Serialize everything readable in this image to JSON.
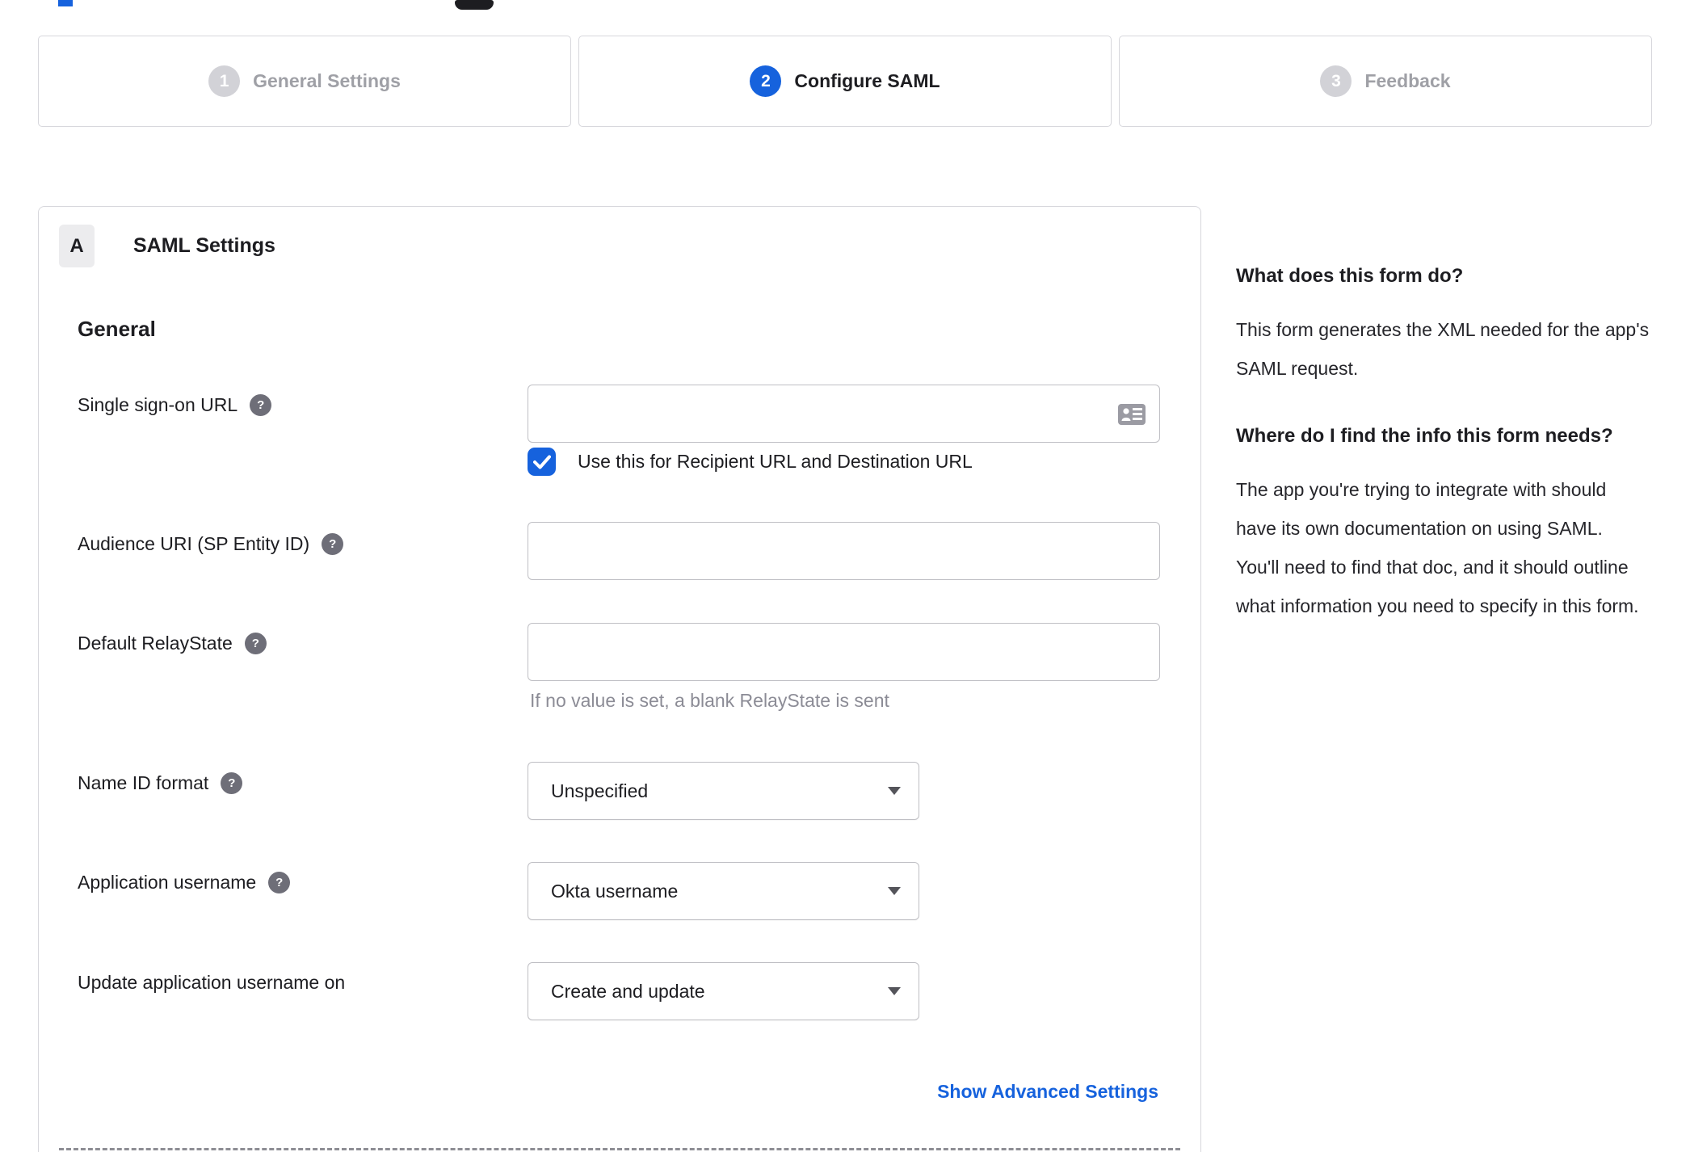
{
  "colors": {
    "accent_blue": "#1662dd",
    "panel_border": "#d7d7dc",
    "input_border": "#bfbfc4",
    "text_dark": "#1d1d21",
    "text_muted": "#8c8c96",
    "inactive_step": "#9fa0a6",
    "help_icon_bg": "#6e6e78",
    "badge_bg": "#ececee"
  },
  "stepper": {
    "steps": [
      {
        "number": "1",
        "label": "General Settings",
        "state": "inactive"
      },
      {
        "number": "2",
        "label": "Configure SAML",
        "state": "active"
      },
      {
        "number": "3",
        "label": "Feedback",
        "state": "inactive"
      }
    ]
  },
  "panel": {
    "badge": "A",
    "title": "SAML Settings",
    "section": "General",
    "fields": [
      {
        "label": "Single sign-on URL",
        "type": "text",
        "value": "",
        "has_help": true,
        "trailing_icon": "contact-card-icon",
        "checkbox": {
          "checked": true,
          "label": "Use this for Recipient URL and Destination URL"
        }
      },
      {
        "label": "Audience URI (SP Entity ID)",
        "type": "text",
        "value": "",
        "has_help": true
      },
      {
        "label": "Default RelayState",
        "type": "text",
        "value": "",
        "has_help": true,
        "hint": "If no value is set, a blank RelayState is sent"
      },
      {
        "label": "Name ID format",
        "type": "select",
        "value": "Unspecified",
        "has_help": true
      },
      {
        "label": "Application username",
        "type": "select",
        "value": "Okta username",
        "has_help": true
      },
      {
        "label": "Update application username on",
        "type": "select",
        "value": "Create and update",
        "has_help": false
      }
    ],
    "advanced_settings_link": "Show Advanced Settings"
  },
  "sidebar": {
    "sections": [
      {
        "heading": "What does this form do?",
        "body": "This form generates the XML needed for the app's SAML request."
      },
      {
        "heading": "Where do I find the info this form needs?",
        "body": "The app you're trying to integrate with should have its own documentation on using SAML. You'll need to find that doc, and it should outline what information you need to specify in this form."
      }
    ]
  },
  "icons": {
    "help_glyph": "?"
  }
}
